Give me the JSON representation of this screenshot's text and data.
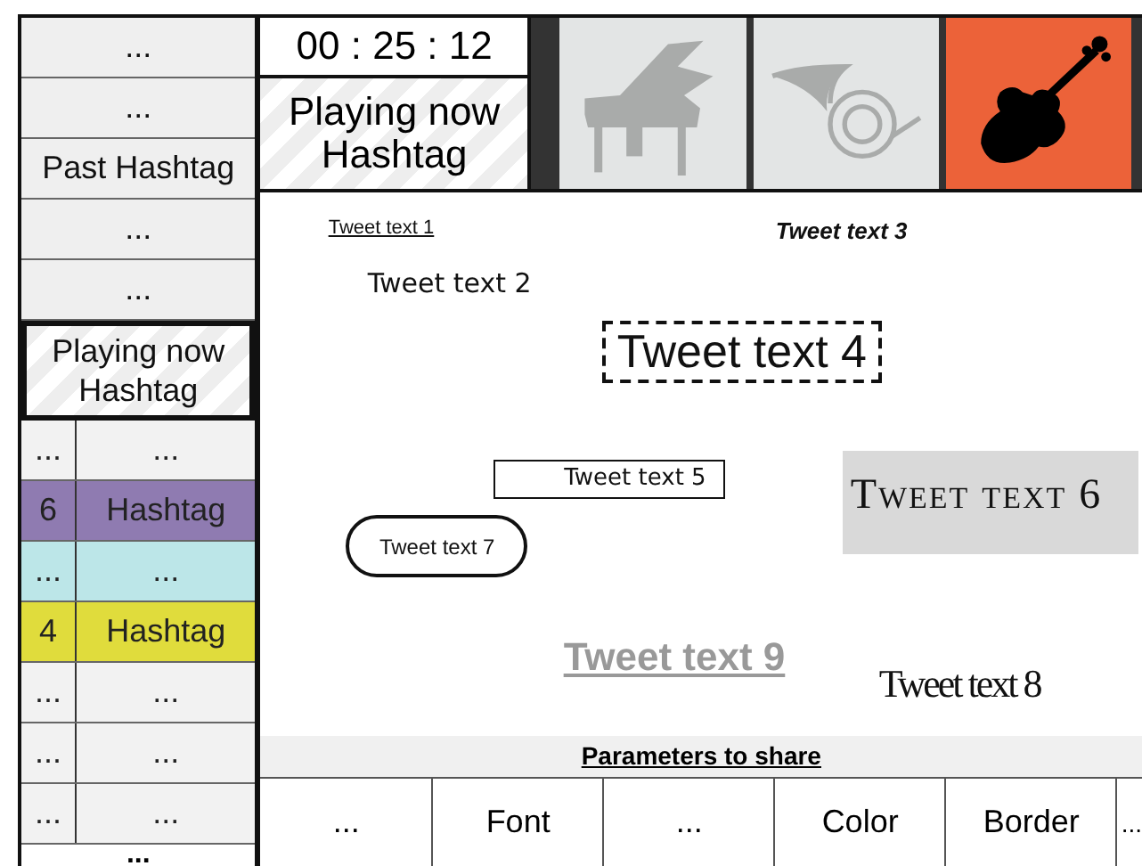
{
  "sidebar": {
    "items": [
      {
        "kind": "single",
        "label": "..."
      },
      {
        "kind": "single",
        "label": "..."
      },
      {
        "kind": "single",
        "label": "Past Hashtag"
      },
      {
        "kind": "single",
        "label": "..."
      },
      {
        "kind": "single",
        "label": "..."
      },
      {
        "kind": "playing",
        "label": "Playing now Hashtag"
      },
      {
        "kind": "pair",
        "count": "...",
        "label": "..."
      },
      {
        "kind": "pair",
        "count": "6",
        "label": "Hashtag",
        "color": "#8f7bb1"
      },
      {
        "kind": "pair",
        "count": "...",
        "label": "...",
        "color": "#bce6e8"
      },
      {
        "kind": "pair",
        "count": "4",
        "label": "Hashtag",
        "color": "#e0dc3c"
      },
      {
        "kind": "pair",
        "count": "...",
        "label": "..."
      },
      {
        "kind": "pair",
        "count": "...",
        "label": "..."
      },
      {
        "kind": "pair",
        "count": "...",
        "label": "..."
      },
      {
        "kind": "more",
        "label": "..."
      }
    ]
  },
  "timer": "00 : 25 : 12",
  "now_playing": "Playing now Hashtag",
  "instruments": [
    {
      "kind": "piano",
      "selected": false
    },
    {
      "kind": "horn",
      "selected": false
    },
    {
      "kind": "violin",
      "selected": true
    }
  ],
  "tweets": [
    {
      "kind": "small-link",
      "text": "Tweet text 1"
    },
    {
      "kind": "plain",
      "text": "Tweet text 2"
    },
    {
      "kind": "bold-italic",
      "text": "Tweet text 3"
    },
    {
      "kind": "dashed",
      "text": "Tweet text 4"
    },
    {
      "kind": "boxed",
      "text": "Tweet text 5"
    },
    {
      "kind": "caps",
      "text": "Tweet text 6"
    },
    {
      "kind": "pill",
      "text": "Tweet text 7"
    },
    {
      "kind": "condensed",
      "text": "Tweet text 8"
    },
    {
      "kind": "grey",
      "text": "Tweet text 9"
    }
  ],
  "parameters": {
    "title": "Parameters to share",
    "items": [
      "...",
      "Font",
      "...",
      "Color",
      "Border",
      "..."
    ]
  }
}
